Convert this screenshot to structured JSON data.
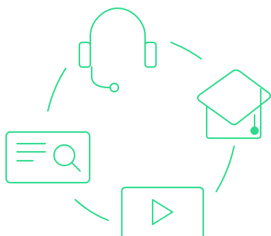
{
  "illustration": {
    "accent_color": "#2EDB8E",
    "background_color": "#FFFFFF",
    "icons": [
      "headset-icon",
      "graduation-cap-icon",
      "video-play-icon",
      "document-search-icon"
    ]
  }
}
